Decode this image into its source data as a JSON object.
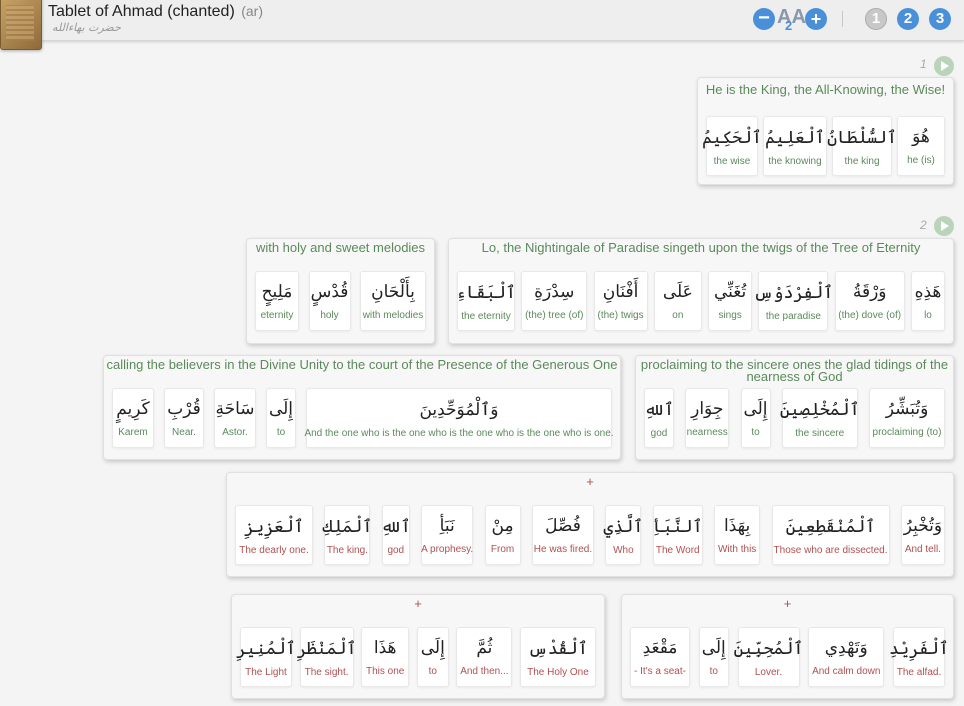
{
  "header": {
    "title": "Tablet of Ahmad (chanted)",
    "lang": "(ar)",
    "subtitle": "حضرت بهاءالله",
    "minus": "−",
    "plus": "+",
    "aa_main": "AA",
    "aa_sub": "2",
    "nums": [
      "1",
      "2",
      "3"
    ]
  },
  "verses": [
    {
      "num": "1"
    },
    {
      "num": "2"
    }
  ],
  "phrases": [
    {
      "title": "He is the King, the All-Knowing, the Wise!",
      "words": [
        [
          "هُوَ",
          "he (is)"
        ],
        [
          "ٱلسُّلْطَانُ",
          "the king"
        ],
        [
          "ٱلْعَلِيمُ",
          "the knowing"
        ],
        [
          "ٱلْحَكِيمُ",
          "the wise"
        ]
      ]
    },
    {
      "title": "Lo, the Nightingale of Paradise singeth upon the twigs of the Tree of Eternity",
      "words": [
        [
          "هَذِهِ",
          "lo"
        ],
        [
          "وَرْقَةُ",
          "(the) dove (of)"
        ],
        [
          "ٱلْفِرْدَوْسِ",
          "the paradise"
        ],
        [
          "تُغَنِّي",
          "sings"
        ],
        [
          "عَلَى",
          "on"
        ],
        [
          "أَفْنَانِ",
          "(the) twigs"
        ],
        [
          "سِدْرَةِ",
          "(the) tree (of)"
        ],
        [
          "ٱلْبَقَاءِ",
          "the eternity"
        ]
      ]
    },
    {
      "title": "with holy and sweet melodies",
      "words": [
        [
          "بِأَلْحَانِ",
          "with melodies"
        ],
        [
          "قُدْسٍ",
          "holy"
        ],
        [
          "مَلِيحٍ",
          "eternity"
        ]
      ]
    },
    {
      "title": "proclaiming to the sincere ones the glad tidings of the nearness of God",
      "words": [
        [
          "وَتُبَشِّرُ",
          "proclaiming (to)"
        ],
        [
          "ٱلْمُخْلِصِينَ",
          "the sincere"
        ],
        [
          "إِلَى",
          "to"
        ],
        [
          "جِوَارِ",
          "nearness"
        ],
        [
          "ٱللهِ",
          "god"
        ]
      ]
    },
    {
      "title": "calling the believers in the Divine Unity to the court of the Presence of the Generous One",
      "words": [
        [
          "وَٱلْمُوَحِّدِينَ",
          "And the one who is the one who is the one who is the one who is one."
        ],
        [
          "إِلَى",
          "to"
        ],
        [
          "سَاحَةِ",
          "Astor."
        ],
        [
          "قُرْبِ",
          "Near."
        ],
        [
          "كَرِيمٍ",
          "Karem"
        ]
      ]
    },
    {
      "title": "+",
      "words": [
        [
          "وَتُخْبِرُ",
          "And tell."
        ],
        [
          "ٱلْمُنْقَطِعِينَ",
          "Those who are dissected."
        ],
        [
          "بِهَذَا",
          "With this"
        ],
        [
          "ٱلنَّبَأِ",
          "The Word"
        ],
        [
          "ٱلَّذِي",
          "Who"
        ],
        [
          "فُصِّلَ",
          "He was fired."
        ],
        [
          "مِنْ",
          "From"
        ],
        [
          "نَبَأِ",
          "A prophesy."
        ],
        [
          "ٱللهِ",
          "god"
        ],
        [
          "ٱلْمَلِكِ",
          "The king."
        ],
        [
          "ٱلْعَزِيزِ",
          "The dearly one."
        ]
      ]
    },
    {
      "title": "+",
      "words": [
        [
          "ٱلْفَرِيْدِ",
          "The alfad."
        ],
        [
          "وَتَهْدِي",
          "And calm down"
        ],
        [
          "ٱلْمُحِبِّينَ",
          "Lover."
        ],
        [
          "إِلَى",
          "to"
        ],
        [
          "مَقْعَدِ",
          "- It's a seat-"
        ]
      ]
    },
    {
      "title": "+",
      "words": [
        [
          "ٱلْقُدْسِ",
          "The Holy One"
        ],
        [
          "ثُمَّ",
          "And then..."
        ],
        [
          "إِلَى",
          "to"
        ],
        [
          "هَذَا",
          "This one"
        ],
        [
          "ٱلْمَنْظَرِ",
          "The sight."
        ],
        [
          "ٱلْمُنِيرِ",
          "The Light"
        ]
      ]
    }
  ]
}
